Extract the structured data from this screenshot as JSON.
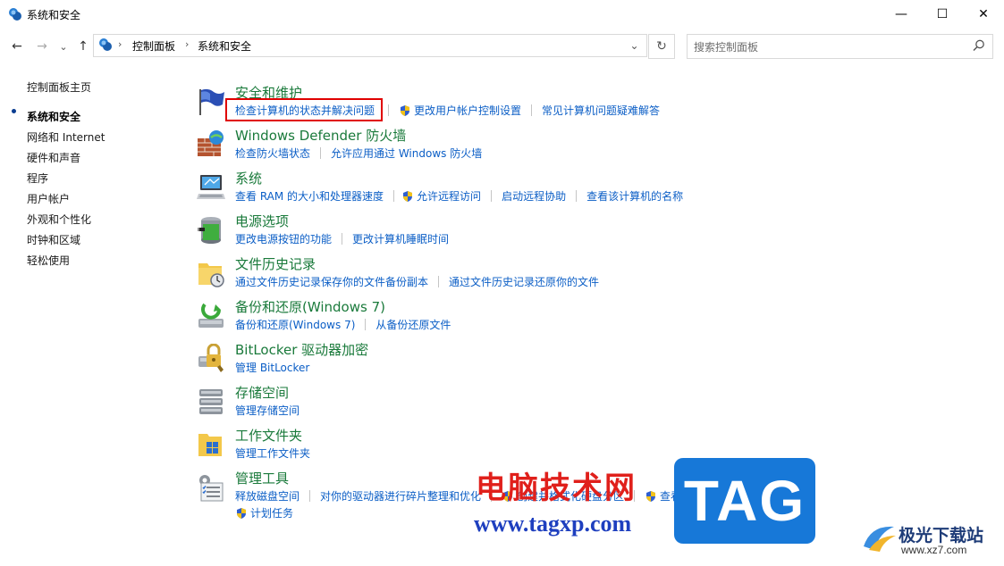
{
  "window": {
    "title": "系统和安全",
    "controls": {
      "minimize": "—",
      "maximize": "☐",
      "close": "✕"
    }
  },
  "nav": {
    "back": "←",
    "forward": "→",
    "recent": "⌄",
    "up": "↑",
    "breadcrumb": [
      "控制面板",
      "系统和安全"
    ],
    "breadcrumb_sep": "›",
    "dropdown": "⌄",
    "refresh": "↻"
  },
  "search": {
    "placeholder": "搜索控制面板"
  },
  "left_nav": {
    "home": "控制面板主页",
    "active": "系统和安全",
    "items": [
      "网络和 Internet",
      "硬件和声音",
      "程序",
      "用户帐户",
      "外观和个性化",
      "时钟和区域",
      "轻松使用"
    ]
  },
  "categories": [
    {
      "title": "安全和维护",
      "icon": "flag-icon",
      "links": [
        {
          "text": "检查计算机的状态并解决问题"
        },
        {
          "text": "更改用户帐户控制设置",
          "shield": true
        },
        {
          "text": "常见计算机问题疑难解答"
        }
      ]
    },
    {
      "title": "Windows Defender 防火墙",
      "icon": "firewall-icon",
      "links": [
        {
          "text": "检查防火墙状态"
        },
        {
          "text": "允许应用通过 Windows 防火墙"
        }
      ]
    },
    {
      "title": "系统",
      "icon": "computer-icon",
      "links": [
        {
          "text": "查看 RAM 的大小和处理器速度"
        },
        {
          "text": "允许远程访问",
          "shield": true
        },
        {
          "text": "启动远程协助"
        },
        {
          "text": "查看该计算机的名称"
        }
      ]
    },
    {
      "title": "电源选项",
      "icon": "battery-icon",
      "links": [
        {
          "text": "更改电源按钮的功能"
        },
        {
          "text": "更改计算机睡眠时间"
        }
      ]
    },
    {
      "title": "文件历史记录",
      "icon": "file-history-icon",
      "links": [
        {
          "text": "通过文件历史记录保存你的文件备份副本"
        },
        {
          "text": "通过文件历史记录还原你的文件"
        }
      ]
    },
    {
      "title": "备份和还原(Windows 7)",
      "icon": "backup-icon",
      "links": [
        {
          "text": "备份和还原(Windows 7)"
        },
        {
          "text": "从备份还原文件"
        }
      ]
    },
    {
      "title": "BitLocker 驱动器加密",
      "icon": "bitlocker-icon",
      "links": [
        {
          "text": "管理 BitLocker"
        }
      ]
    },
    {
      "title": "存储空间",
      "icon": "storage-icon",
      "links": [
        {
          "text": "管理存储空间"
        }
      ]
    },
    {
      "title": "工作文件夹",
      "icon": "work-folders-icon",
      "links": [
        {
          "text": "管理工作文件夹"
        }
      ]
    },
    {
      "title": "管理工具",
      "icon": "admin-tools-icon",
      "links": [
        {
          "text": "释放磁盘空间"
        },
        {
          "text": "对你的驱动器进行碎片整理和优化"
        },
        {
          "text": "创建并格式化硬盘分区",
          "shield": true
        },
        {
          "text": "查看事件日志",
          "shield": true
        }
      ],
      "links2": [
        {
          "text": "计划任务",
          "shield": true
        }
      ]
    }
  ],
  "watermark": {
    "cn": "电脑技术网",
    "url": "www.tagxp.com",
    "tag": "TAG",
    "site_cn": "极光下载站",
    "site_en": "www.xz7.com"
  }
}
